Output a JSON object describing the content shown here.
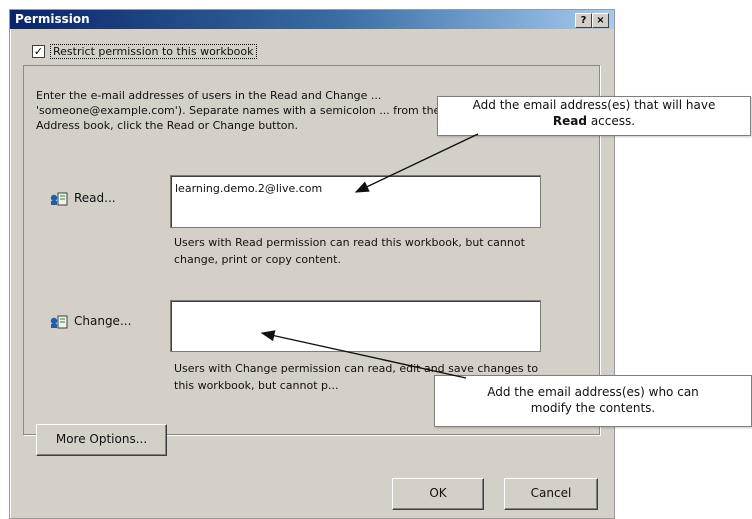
{
  "dialog": {
    "title": "Permission",
    "help_btn": "?",
    "close_btn": "×",
    "restrict_label": "Restrict permission to this workbook",
    "restrict_checked": true,
    "instructions": "Enter the e-mail addresses of users in the Read and Change ... 'someone@example.com'). Separate names with a semicolon ... from the Address book, click the Read or Change button.",
    "read": {
      "button_label": "Read...",
      "value": "learning.demo.2@live.com",
      "help": "Users with Read permission can read this workbook, but cannot change, print or copy content."
    },
    "change": {
      "button_label": "Change...",
      "value": "",
      "help": "Users with Change permission can read, edit and save changes to this workbook, but cannot p..."
    },
    "more_options_label": "More Options...",
    "ok_label": "OK",
    "cancel_label": "Cancel"
  },
  "callouts": {
    "read": {
      "text": "Add the email address(es) that will have",
      "bold": "Read",
      "suffix": "access."
    },
    "change": {
      "line1": "Add the email address(es) who can",
      "line2": "modify the contents."
    }
  },
  "colors": {
    "dialog_bg": "#d4d0c8",
    "title_start": "#0a246a",
    "title_end": "#a6caf0"
  }
}
